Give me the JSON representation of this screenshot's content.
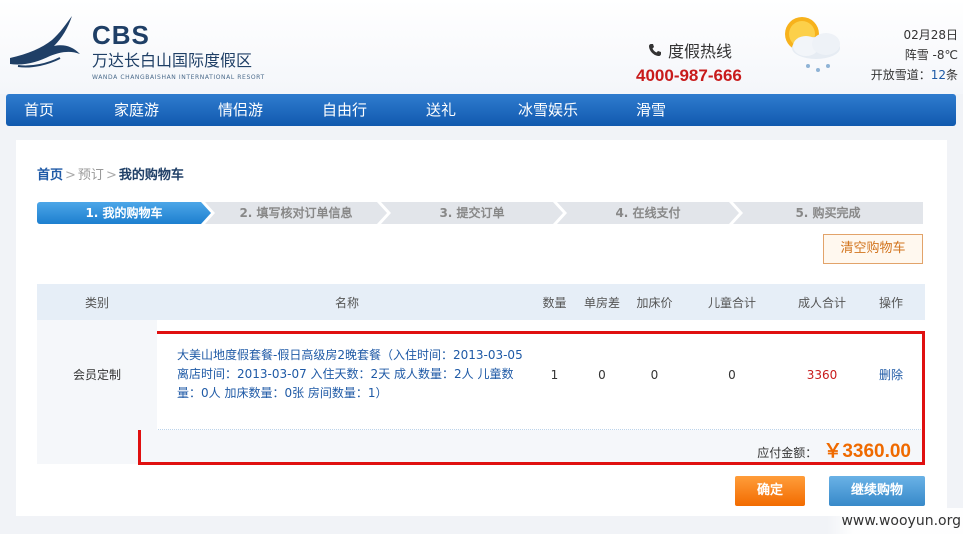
{
  "header": {
    "logo_mark": "CBS",
    "logo_name": "万达长白山国际度假区",
    "logo_en": "WANDA CHANGBAISHAN INTERNATIONAL RESORT",
    "hotline_label": "度假热线",
    "hotline_number": "4000-987-666",
    "weather": {
      "date": "02月28日",
      "condition": "阵雪 -8℃",
      "runs_label": "开放雪道：",
      "runs_count": "12",
      "runs_unit": "条"
    }
  },
  "nav": {
    "items": [
      "首页",
      "家庭游",
      "情侣游",
      "自由行",
      "送礼",
      "冰雪娱乐",
      "滑雪"
    ]
  },
  "breadcrumb": {
    "home": "首页",
    "sep": ">",
    "middle": "预订",
    "current": "我的购物车"
  },
  "steps": [
    "1. 我的购物车",
    "2. 填写核对订单信息",
    "3. 提交订单",
    "4. 在线支付",
    "5. 购买完成"
  ],
  "clear_cart_label": "清空购物车",
  "table": {
    "headers": [
      "类别",
      "名称",
      "数量",
      "单房差",
      "加床价",
      "儿童合计",
      "成人合计",
      "操作"
    ],
    "rows": [
      {
        "type": "会员定制",
        "name": "大美山地度假套餐-假日高级房2晚套餐（入住时间：2013-03-05 离店时间：2013-03-07 入住天数：2天 成人数量：2人 儿童数量：0人 加床数量：0张 房间数量：1）",
        "qty": "1",
        "single_diff": "0",
        "extra_bed": "0",
        "child_total": "0",
        "adult_total": "3360",
        "action": "删除"
      }
    ]
  },
  "total": {
    "label": "应付金额：",
    "amount": "￥3360.00"
  },
  "confirm_label": "确定",
  "continue_label": "继续购物",
  "watermark": "www.wooyun.org",
  "colors": {
    "nav_blue": "#1a66bb",
    "price_red": "#c81b1b",
    "total_orange": "#ef6a00",
    "highlight_red": "#e01010"
  }
}
